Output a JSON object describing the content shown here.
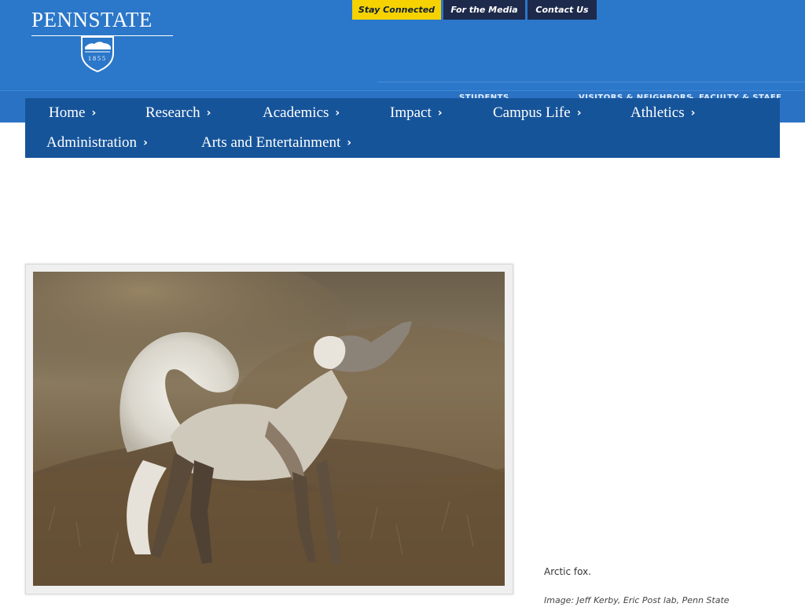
{
  "brand": {
    "wordmark": "PENNSTATE",
    "seal_year": "1855",
    "colors": {
      "header_blue": "#2b77c9",
      "nav_blue": "#16549a",
      "highlight_yellow": "#f5d200",
      "dark_navy": "#1d2a4b"
    }
  },
  "utility_links": [
    {
      "label": "Stay Connected"
    },
    {
      "label": "For the Media"
    },
    {
      "label": "Contact Us"
    }
  ],
  "audience_links": [
    {
      "label": "STUDENTS"
    },
    {
      "label": "VISITORS & NEIGHBORS"
    },
    {
      "label": "FACULTY & STAFF"
    }
  ],
  "nav": {
    "chevron_icon": "chevron-right-icon",
    "items": [
      {
        "label": "Home"
      },
      {
        "label": "Research"
      },
      {
        "label": "Academics"
      },
      {
        "label": "Impact"
      },
      {
        "label": "Campus Life"
      },
      {
        "label": "Athletics"
      },
      {
        "label": "Administration"
      },
      {
        "label": "Arts and Entertainment"
      }
    ]
  },
  "figure": {
    "alt": "Arctic fox",
    "caption": "Arctic fox.",
    "credit": "Image: Jeff Kerby, Eric Post lab, Penn State"
  }
}
